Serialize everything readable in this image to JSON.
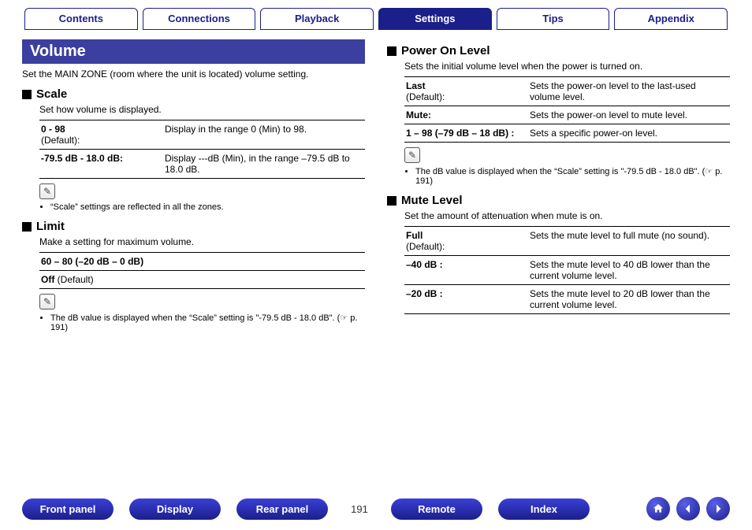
{
  "tabs": [
    {
      "label": "Contents",
      "active": false
    },
    {
      "label": "Connections",
      "active": false
    },
    {
      "label": "Playback",
      "active": false
    },
    {
      "label": "Settings",
      "active": true
    },
    {
      "label": "Tips",
      "active": false
    },
    {
      "label": "Appendix",
      "active": false
    }
  ],
  "left": {
    "heading": "Volume",
    "intro": "Set the MAIN ZONE (room where the unit is located) volume setting.",
    "scale": {
      "title": "Scale",
      "desc": "Set how volume is displayed.",
      "rows": [
        {
          "k": "0 - 98",
          "sub": "(Default):",
          "v": "Display in the range 0 (Min) to 98."
        },
        {
          "k": "-79.5 dB - 18.0 dB:",
          "sub": "",
          "v": "Display ---dB (Min), in the range –79.5 dB to 18.0 dB."
        }
      ],
      "note": "“Scale” settings are reflected in all the zones."
    },
    "limit": {
      "title": "Limit",
      "desc": "Make a setting for maximum volume.",
      "rows": [
        {
          "k": "60 – 80 (–20 dB – 0 dB)",
          "sub": ""
        },
        {
          "k": "Off",
          "sub": " (Default)"
        }
      ],
      "note": "The dB value is displayed when the “Scale” setting is \"-79.5 dB - 18.0 dB\". (☞ p. 191)"
    }
  },
  "right": {
    "power": {
      "title": "Power On Level",
      "desc": "Sets the initial volume level when the power is turned on.",
      "rows": [
        {
          "k": "Last",
          "sub": "(Default):",
          "v": "Sets the power-on level to the last-used volume level."
        },
        {
          "k": "Mute:",
          "sub": "",
          "v": "Sets the power-on level to mute level."
        },
        {
          "k": "1 – 98 (–79 dB – 18 dB) :",
          "sub": "",
          "v": "Sets a specific power-on level."
        }
      ],
      "note": "The dB value is displayed when the “Scale” setting is \"-79.5 dB - 18.0 dB\". (☞ p. 191)"
    },
    "mute": {
      "title": "Mute Level",
      "desc": "Set the amount of attenuation when mute is on.",
      "rows": [
        {
          "k": "Full",
          "sub": "(Default):",
          "v": "Sets the mute level to full mute (no sound)."
        },
        {
          "k": "–40 dB :",
          "sub": "",
          "v": "Sets the mute level to 40 dB lower than the current volume level."
        },
        {
          "k": "–20 dB :",
          "sub": "",
          "v": "Sets the mute level to 20 dB lower than the current volume level."
        }
      ]
    }
  },
  "footer": {
    "buttons": [
      "Front panel",
      "Display",
      "Rear panel"
    ],
    "page": "191",
    "buttons2": [
      "Remote",
      "Index"
    ]
  }
}
